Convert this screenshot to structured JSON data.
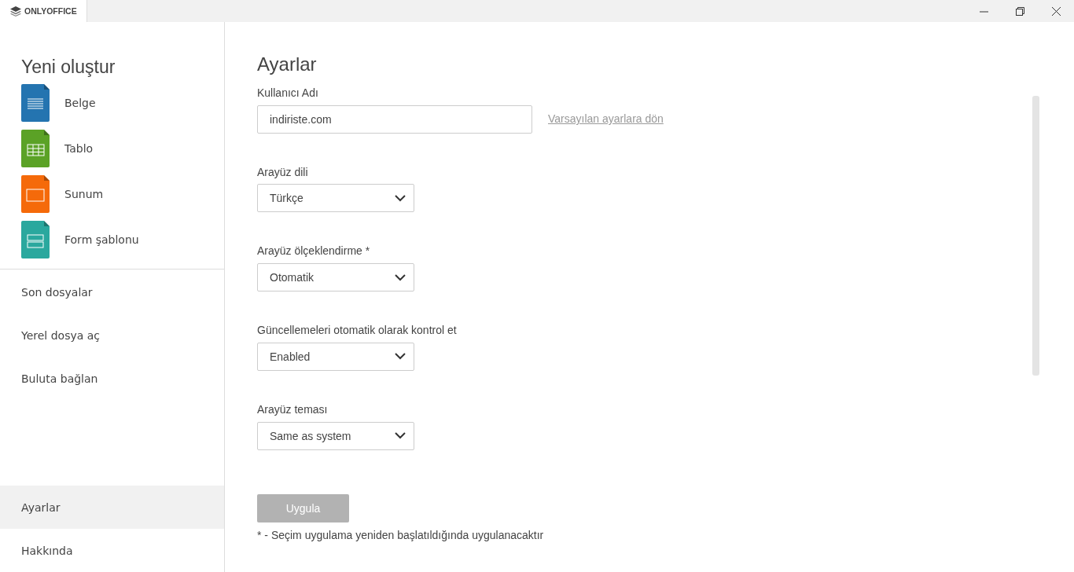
{
  "titlebar": {
    "logo": "ONLYOFFICE"
  },
  "sidebar": {
    "create_title": "Yeni oluştur",
    "create_items": [
      {
        "label": "Belge",
        "kind": "document",
        "color": "#2474b0"
      },
      {
        "label": "Tablo",
        "kind": "spreadsheet",
        "color": "#5ba226"
      },
      {
        "label": "Sunum",
        "kind": "presentation",
        "color": "#f56a0a"
      },
      {
        "label": "Form şablonu",
        "kind": "form",
        "color": "#2aa89e"
      }
    ],
    "nav": [
      {
        "label": "Son dosyalar",
        "selected": false
      },
      {
        "label": "Yerel dosya aç",
        "selected": false
      },
      {
        "label": "Buluta bağlan",
        "selected": false
      }
    ],
    "bottom_nav": [
      {
        "label": "Ayarlar",
        "selected": true
      },
      {
        "label": "Hakkında",
        "selected": false
      }
    ]
  },
  "settings": {
    "title": "Ayarlar",
    "username": {
      "label": "Kullanıcı Adı",
      "value": "indiriste.com",
      "reset_link": "Varsayılan ayarlara dön"
    },
    "selects": [
      {
        "label": "Arayüz dili",
        "value": "Türkçe"
      },
      {
        "label": "Arayüz ölçeklendirme *",
        "value": "Otomatik"
      },
      {
        "label": "Güncellemeleri otomatik olarak kontrol et",
        "value": "Enabled"
      },
      {
        "label": "Arayüz teması",
        "value": "Same as system"
      }
    ],
    "apply_button": {
      "label": "Uygula",
      "disabled": true
    },
    "note": "* - Seçim uygulama yeniden başlatıldığında uygulanacaktır"
  }
}
